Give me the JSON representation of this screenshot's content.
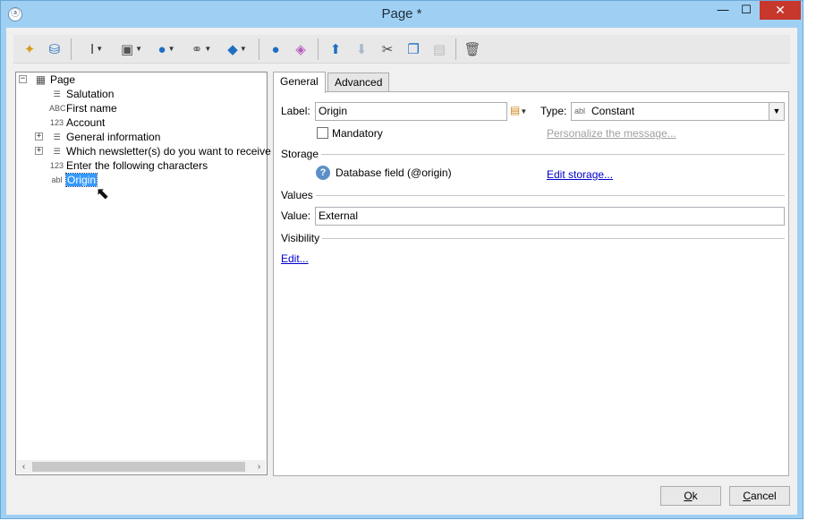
{
  "window": {
    "title": "Page *",
    "min_glyph": "—",
    "max_glyph": "☐",
    "close_glyph": "✕"
  },
  "toolbar": {
    "items": [
      {
        "icon": "magic-wand-icon",
        "glyph": "✦",
        "color": "#d89a1a"
      },
      {
        "icon": "database-icon",
        "glyph": "⛁",
        "color": "#1f6fc2"
      },
      {
        "icon": "text-cursor-icon",
        "glyph": "Ⅰ",
        "color": "#444444"
      },
      {
        "icon": "form-field-icon",
        "glyph": "▣",
        "color": "#555555"
      },
      {
        "icon": "globe-icon",
        "glyph": "●",
        "color": "#1f6fc2"
      },
      {
        "icon": "link-icon",
        "glyph": "⚭",
        "color": "#666666"
      },
      {
        "icon": "box-icon",
        "glyph": "◆",
        "color": "#1f6fc2"
      },
      {
        "icon": "person-icon",
        "glyph": "●",
        "color": "#1f6fc2"
      },
      {
        "icon": "shapes-icon",
        "glyph": "◈",
        "color": "#b35abf"
      },
      {
        "icon": "move-up-icon",
        "glyph": "⬆",
        "color": "#1f6fc2"
      },
      {
        "icon": "move-down-icon",
        "glyph": "⬇",
        "color": "#a8b8cc"
      },
      {
        "icon": "cut-icon",
        "glyph": "✂",
        "color": "#444444"
      },
      {
        "icon": "copy-icon",
        "glyph": "❐",
        "color": "#1f6fc2"
      },
      {
        "icon": "paste-icon",
        "glyph": "▤",
        "color": "#bbbbbb"
      },
      {
        "icon": "delete-icon",
        "glyph": "🗑",
        "color": "#555555"
      }
    ]
  },
  "tree": {
    "root": {
      "label": "Page",
      "expander": "−"
    },
    "items": [
      {
        "label": "Salutation",
        "icon": "list-icon",
        "glyph": "☰",
        "expander": ""
      },
      {
        "label": "First name",
        "icon": "text-field-icon",
        "glyph": "ABC",
        "expander": ""
      },
      {
        "label": "Account",
        "icon": "number-field-icon",
        "glyph": "123",
        "expander": ""
      },
      {
        "label": "General information",
        "icon": "list-icon",
        "glyph": "☰",
        "expander": "+"
      },
      {
        "label": "Which newsletter(s) do you want to receive",
        "icon": "list-icon",
        "glyph": "☰",
        "expander": "+"
      },
      {
        "label": "Enter the following characters",
        "icon": "captcha-icon",
        "glyph": "123",
        "expander": ""
      },
      {
        "label": "Origin",
        "icon": "constant-field-icon",
        "glyph": "abl",
        "expander": "",
        "selected": true
      }
    ],
    "scroll_left": "‹",
    "scroll_right": "›"
  },
  "tabs": [
    {
      "label": "General",
      "active": true
    },
    {
      "label": "Advanced",
      "active": false
    }
  ],
  "form": {
    "label_caption": "Label:",
    "label_value": "Origin",
    "type_caption": "Type:",
    "type_icon_text": "abl",
    "type_value": "Constant",
    "mandatory_label": "Mandatory",
    "mandatory_checked": false,
    "personalize_link": "Personalize the message...",
    "storage_header": "Storage",
    "storage_text": "Database field (@origin)",
    "edit_storage_link": "Edit storage...",
    "values_header": "Values",
    "value_caption": "Value:",
    "value_value": "External",
    "visibility_header": "Visibility",
    "edit_link": "Edit..."
  },
  "buttons": {
    "ok_mnemonic": "O",
    "ok_rest": "k",
    "cancel_mnemonic": "C",
    "cancel_rest": "ancel"
  }
}
